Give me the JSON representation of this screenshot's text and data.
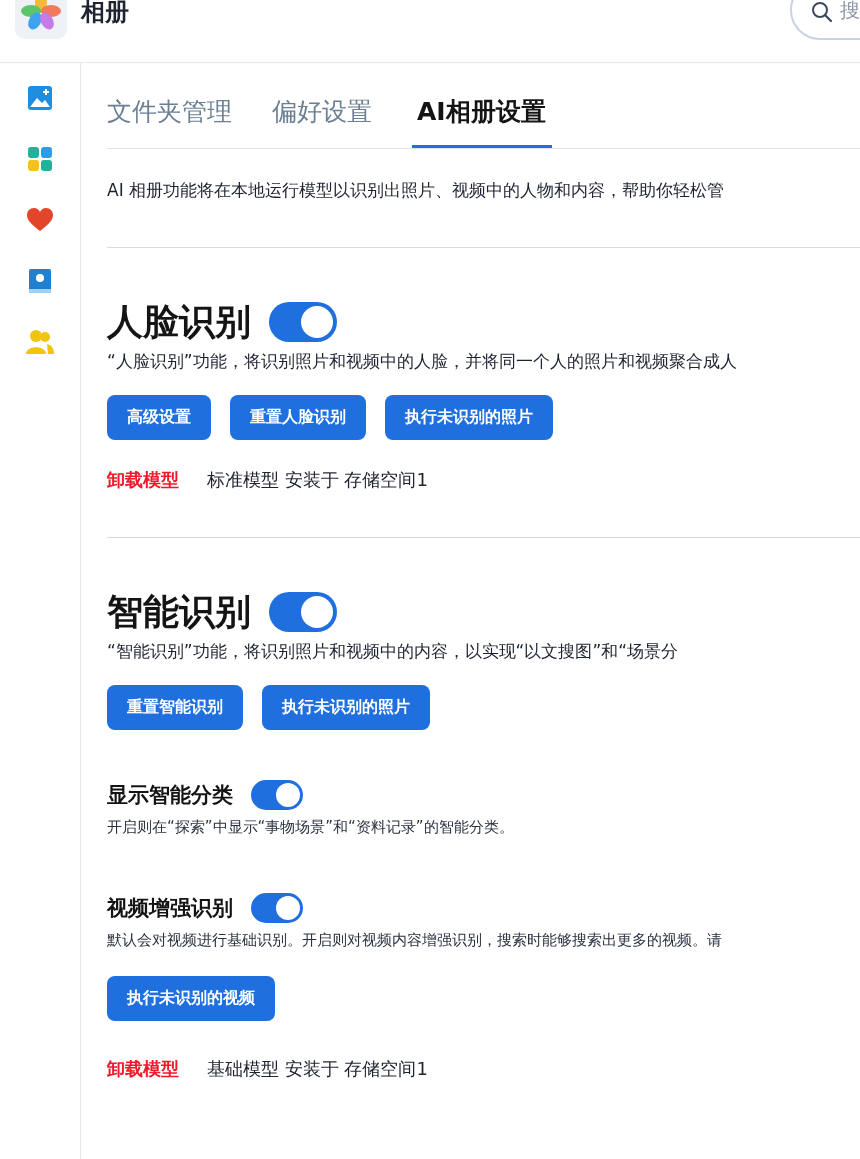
{
  "app": {
    "title": "相册"
  },
  "search": {
    "placeholder": "搜"
  },
  "sidebar": {
    "items": [
      {
        "kind": "photos",
        "selected": false
      },
      {
        "kind": "apps",
        "selected": false
      },
      {
        "kind": "favorites",
        "selected": false
      },
      {
        "kind": "album",
        "selected": false
      },
      {
        "kind": "people",
        "selected": false
      }
    ]
  },
  "tabs": [
    {
      "label": "文件夹管理",
      "selected": false
    },
    {
      "label": "偏好设置",
      "selected": false
    },
    {
      "label": "AI相册设置",
      "selected": true
    }
  ],
  "intro": "AI 相册功能将在本地运行模型以识别出照片、视频中的人物和内容，帮助你轻松管",
  "sections": [
    {
      "title": "人脸识别",
      "on": true,
      "description": "“人脸识别”功能，将识别照片和视频中的人脸，并将同一个人的照片和视频聚合成人",
      "buttons": [
        "高级设置",
        "重置人脸识别",
        "执行未识别的照片"
      ],
      "model": {
        "action": "卸载模型",
        "info": "标准模型 安装于 存储空间1"
      }
    },
    {
      "title": "智能识别",
      "on": true,
      "description": "“智能识别”功能，将识别照片和视频中的内容，以实现“以文搜图”和“场景分",
      "buttons": [
        "重置智能识别",
        "执行未识别的照片"
      ],
      "settings": [
        {
          "title": "显示智能分类",
          "on": true,
          "description": "开启则在“探索”中显示“事物场景”和“资料记录”的智能分类。"
        },
        {
          "title": "视频增强识别",
          "on": true,
          "description": "默认会对视频进行基础识别。开启则对视频内容增强识别，搜索时能够搜索出更多的视频。请",
          "buttons": [
            "执行未识别的视频"
          ]
        }
      ],
      "model": {
        "action": "卸载模型",
        "info": "基础模型 安装于 存储空间1"
      }
    }
  ]
}
